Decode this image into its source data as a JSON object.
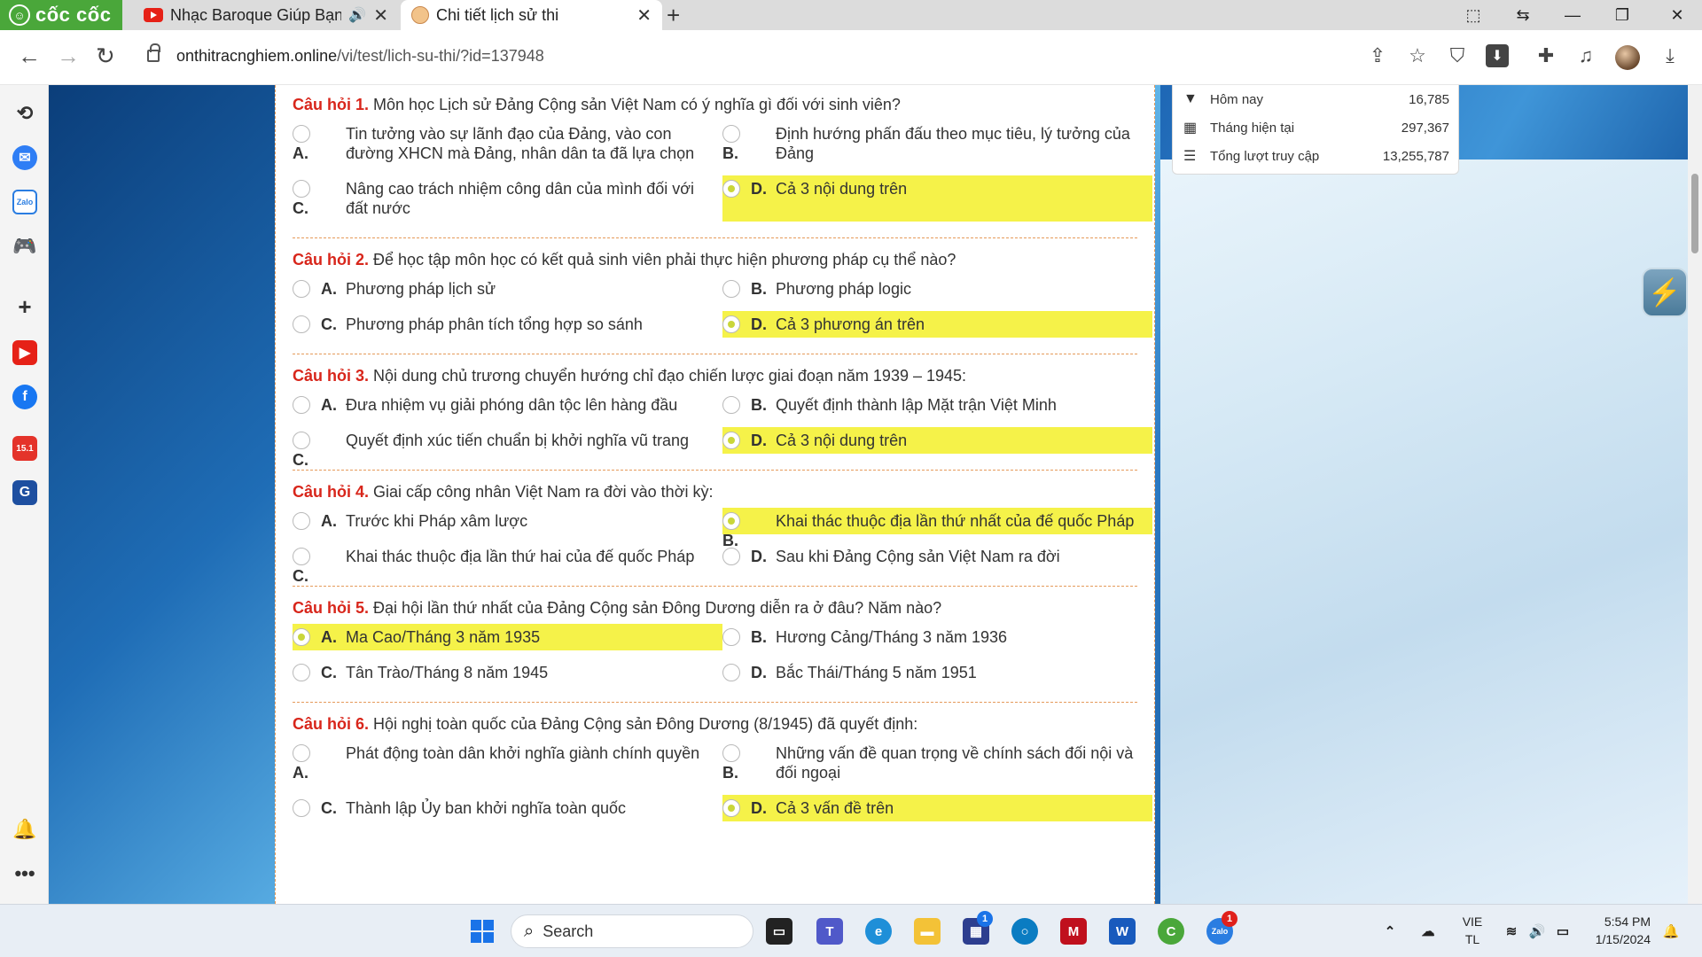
{
  "browser": {
    "brand": "cốc cốc",
    "tabs": [
      {
        "title": "Nhạc Baroque Giúp Bạn T",
        "icon": "youtube-icon",
        "audio": true
      },
      {
        "title": "Chi tiết lịch sử thi",
        "icon": "site-favicon",
        "active": true
      }
    ],
    "url_host": "onthitracnghiem.online",
    "url_path": "/vi/test/lich-su-thi/?id=137948"
  },
  "stats": [
    {
      "icon": "filter-icon",
      "label": "Hôm nay",
      "value": "16,785"
    },
    {
      "icon": "calendar-icon",
      "label": "Tháng hiện tại",
      "value": "297,367"
    },
    {
      "icon": "list-icon",
      "label": "Tổng lượt truy cập",
      "value": "13,255,787"
    }
  ],
  "questions": [
    {
      "label": "Câu hỏi 1.",
      "text": "Môn học Lịch sử Đảng Cộng sản Việt Nam có ý nghĩa gì đối với sinh viên?",
      "options": [
        {
          "letter": "A.",
          "text": "Tin tưởng vào sự lãnh đạo của Đảng, vào con đường XHCN mà Đảng, nhân dân ta đã lựa chọn",
          "selected": false,
          "stacked": true
        },
        {
          "letter": "B.",
          "text": "Định hướng phấn đấu theo mục tiêu, lý tưởng của Đảng",
          "selected": false,
          "stacked": true
        },
        {
          "letter": "C.",
          "text": "Nâng cao trách nhiệm công dân của mình đối với đất nước",
          "selected": false,
          "stacked": true
        },
        {
          "letter": "D.",
          "text": "Cả 3 nội dung trên",
          "selected": true,
          "stacked": false
        }
      ]
    },
    {
      "label": "Câu hỏi 2.",
      "text": "Để học tập môn học có kết quả sinh viên phải thực hiện phương pháp cụ thể nào?",
      "options": [
        {
          "letter": "A.",
          "text": "Phương pháp lịch sử",
          "selected": false,
          "stacked": false
        },
        {
          "letter": "B.",
          "text": "Phương pháp logic",
          "selected": false,
          "stacked": false
        },
        {
          "letter": "C.",
          "text": "Phương pháp phân tích tổng hợp so sánh",
          "selected": false,
          "stacked": false
        },
        {
          "letter": "D.",
          "text": "Cả 3 phương án trên",
          "selected": true,
          "stacked": false
        }
      ]
    },
    {
      "label": "Câu hỏi 3.",
      "text": "Nội dung chủ trương chuyển hướng chỉ đạo chiến lược giai đoạn năm 1939 – 1945:",
      "options": [
        {
          "letter": "A.",
          "text": "Đưa nhiệm vụ giải phóng dân tộc lên hàng đầu",
          "selected": false,
          "stacked": false
        },
        {
          "letter": "B.",
          "text": "Quyết định thành lập Mặt trận Việt Minh",
          "selected": false,
          "stacked": false
        },
        {
          "letter": "C.",
          "text": "Quyết định xúc tiến chuẩn bị khởi nghĩa vũ trang",
          "selected": false,
          "stacked": true
        },
        {
          "letter": "D.",
          "text": "Cả 3 nội dung trên",
          "selected": true,
          "stacked": false
        }
      ]
    },
    {
      "label": "Câu hỏi 4.",
      "text": "Giai cấp công nhân Việt Nam ra đời vào thời kỳ:",
      "options": [
        {
          "letter": "A.",
          "text": "Trước khi Pháp xâm lược",
          "selected": false,
          "stacked": false
        },
        {
          "letter": "B.",
          "text": "Khai thác thuộc địa lần thứ nhất của đế quốc Pháp",
          "selected": true,
          "stacked": true
        },
        {
          "letter": "C.",
          "text": "Khai thác thuộc địa lần thứ hai của đế quốc Pháp",
          "selected": false,
          "stacked": true
        },
        {
          "letter": "D.",
          "text": "Sau khi Đảng Cộng sản Việt Nam ra đời",
          "selected": false,
          "stacked": false
        }
      ]
    },
    {
      "label": "Câu hỏi 5.",
      "text": "Đại hội lần thứ nhất của Đảng Cộng sản Đông Dương diễn ra ở đâu? Năm nào?",
      "options": [
        {
          "letter": "A.",
          "text": "Ma Cao/Tháng 3 năm 1935",
          "selected": true,
          "stacked": false
        },
        {
          "letter": "B.",
          "text": "Hương Cảng/Tháng 3 năm 1936",
          "selected": false,
          "stacked": false
        },
        {
          "letter": "C.",
          "text": "Tân Trào/Tháng 8 năm 1945",
          "selected": false,
          "stacked": false
        },
        {
          "letter": "D.",
          "text": "Bắc Thái/Tháng 5 năm 1951",
          "selected": false,
          "stacked": false
        }
      ]
    },
    {
      "label": "Câu hỏi 6.",
      "text": "Hội nghị toàn quốc của Đảng Cộng sản Đông Dương (8/1945) đã quyết định:",
      "options": [
        {
          "letter": "A.",
          "text": "Phát động toàn dân khởi nghĩa giành chính quyền",
          "selected": false,
          "stacked": true
        },
        {
          "letter": "B.",
          "text": "Những vấn đề quan trọng về chính sách đối nội và đối ngoại",
          "selected": false,
          "stacked": true
        },
        {
          "letter": "C.",
          "text": "Thành lập Ủy ban khởi nghĩa toàn quốc",
          "selected": false,
          "stacked": false
        },
        {
          "letter": "D.",
          "text": "Cả 3 vấn đề trên",
          "selected": true,
          "stacked": false
        }
      ]
    }
  ],
  "taskbar": {
    "search_label": "Search",
    "language": "VIE",
    "language_sub": "TL",
    "time": "5:54 PM",
    "date": "1/15/2024",
    "badge_1": "1",
    "badge_2": "1"
  },
  "colors": {
    "question_number": "#d8261b",
    "selected_highlight": "#f5f249",
    "separator": "#e59a5a",
    "brand_green": "#4aa73a"
  }
}
